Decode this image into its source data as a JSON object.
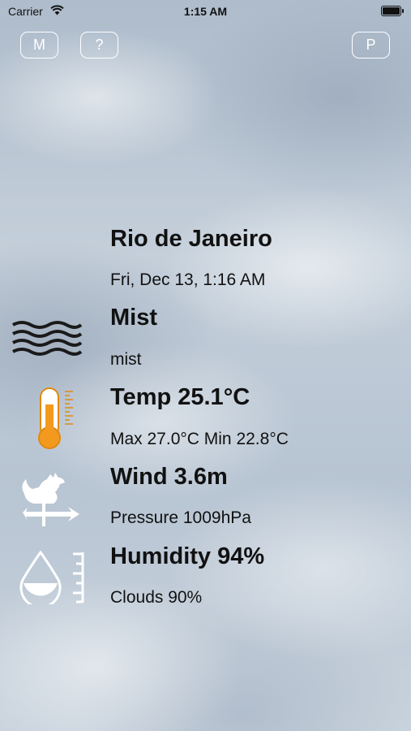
{
  "status_bar": {
    "carrier": "Carrier",
    "time": "1:15 AM"
  },
  "buttons": {
    "map_label": "M",
    "help_label": "?",
    "profile_label": "P"
  },
  "weather": {
    "city": "Rio de Janeiro",
    "datetime": "Fri, Dec 13, 1:16 AM",
    "condition": "Mist",
    "condition_detail": "mist",
    "temp": "Temp 25.1°C",
    "temp_range": "Max 27.0°C Min 22.8°C",
    "wind": "Wind 3.6m",
    "pressure": "Pressure 1009hPa",
    "humidity": "Humidity 94%",
    "clouds": "Clouds 90%"
  },
  "icons": {
    "condition": "mist-icon",
    "temp": "thermometer-icon",
    "wind": "weathervane-rooster-icon",
    "humidity": "humidity-drop-icon"
  },
  "colors": {
    "thermometer": "#f39a1e",
    "button_outline": "#ffffff"
  }
}
